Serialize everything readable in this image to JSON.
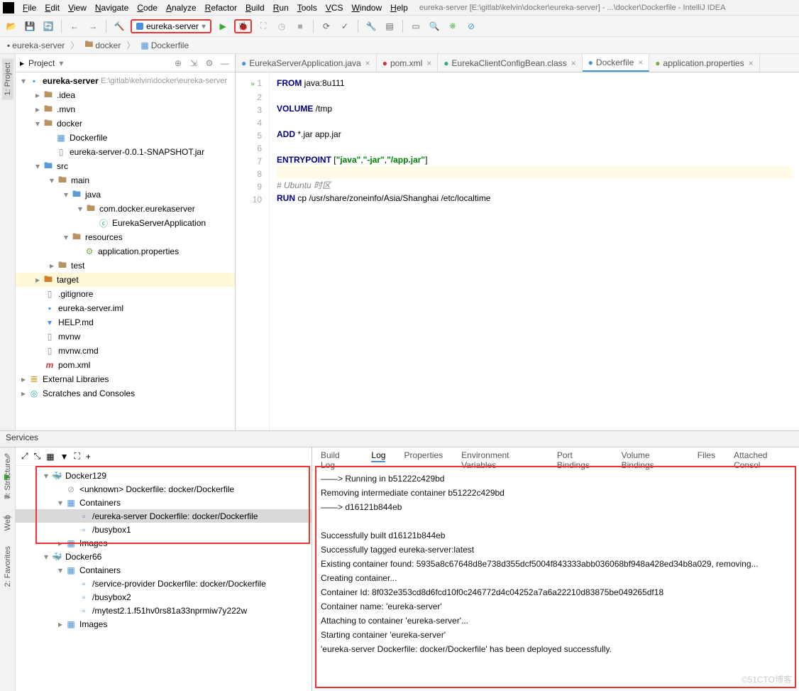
{
  "window": {
    "title": "eureka-server [E:\\gitlab\\kelvin\\docker\\eureka-server] - ...\\docker\\Dockerfile - IntelliJ IDEA"
  },
  "menu": [
    "File",
    "Edit",
    "View",
    "Navigate",
    "Code",
    "Analyze",
    "Refactor",
    "Build",
    "Run",
    "Tools",
    "VCS",
    "Window",
    "Help"
  ],
  "run_config": {
    "label": "eureka-server"
  },
  "breadcrumb": [
    {
      "icon": "module",
      "label": "eureka-server"
    },
    {
      "icon": "folder",
      "label": "docker"
    },
    {
      "icon": "docker",
      "label": "Dockerfile"
    }
  ],
  "project_panel": {
    "title": "Project"
  },
  "tree": {
    "root": {
      "label": "eureka-server",
      "path": "E:\\gitlab\\kelvin\\docker\\eureka-server"
    },
    "idea": ".idea",
    "mvn": ".mvn",
    "docker": "docker",
    "dockerfile": "Dockerfile",
    "snapshot": "eureka-server-0.0.1-SNAPSHOT.jar",
    "src": "src",
    "main": "main",
    "java": "java",
    "pkg": "com.docker.eurekaserver",
    "app": "EurekaServerApplication",
    "resources": "resources",
    "props": "application.properties",
    "test": "test",
    "target": "target",
    "gitignore": ".gitignore",
    "iml": "eureka-server.iml",
    "help": "HELP.md",
    "mvnw": "mvnw",
    "mvnwcmd": "mvnw.cmd",
    "pom": "pom.xml",
    "ext": "External Libraries",
    "scratch": "Scratches and Consoles"
  },
  "editor_tabs": [
    {
      "icon": "java",
      "label": "EurekaServerApplication.java",
      "active": false
    },
    {
      "icon": "maven",
      "label": "pom.xml",
      "active": false
    },
    {
      "icon": "class",
      "label": "EurekaClientConfigBean.class",
      "active": false
    },
    {
      "icon": "docker",
      "label": "Dockerfile",
      "active": true
    },
    {
      "icon": "props",
      "label": "application.properties",
      "active": false
    }
  ],
  "code": {
    "lines": [
      {
        "n": 1,
        "html": "<span class='kw'>FROM</span> java:8u111"
      },
      {
        "n": 2,
        "html": ""
      },
      {
        "n": 3,
        "html": "<span class='kw'>VOLUME</span> /tmp"
      },
      {
        "n": 4,
        "html": ""
      },
      {
        "n": 5,
        "html": "<span class='kw'>ADD</span> *.jar app.jar"
      },
      {
        "n": 6,
        "html": ""
      },
      {
        "n": 7,
        "html": "<span class='kw'>ENTRYPOINT</span> [<span class='str'>\"java\"</span>,<span class='str'>\"-jar\"</span>,<span class='str'>\"/app.jar\"</span>]"
      },
      {
        "n": 8,
        "html": "",
        "caret": true
      },
      {
        "n": 9,
        "html": "<span class='cmt'># Ubuntu 时区</span>"
      },
      {
        "n": 10,
        "html": "<span class='kw'>RUN</span> cp /usr/share/zoneinfo/Asia/Shanghai /etc/localtime"
      }
    ]
  },
  "services": {
    "title": "Services",
    "tabs": [
      "Build Log",
      "Log",
      "Properties",
      "Environment Variables",
      "Port Bindings",
      "Volume Bindings",
      "Files",
      "Attached Consol"
    ],
    "active_tab": "Log",
    "docker129": "Docker129",
    "unknown": "<unknown> Dockerfile: docker/Dockerfile",
    "containers": "Containers",
    "eureka_ct": "/eureka-server Dockerfile: docker/Dockerfile",
    "busybox1": "/busybox1",
    "images": "Images",
    "docker66": "Docker66",
    "svcprovider": "/service-provider Dockerfile: docker/Dockerfile",
    "busybox2": "/busybox2",
    "mytest": "/mytest2.1.f51hv0rs81a33nprmiw7y222w",
    "log": [
      " ——> Running in b51222c429bd",
      "Removing intermediate container b51222c429bd",
      " ——> d16121b844eb",
      "",
      "Successfully built d16121b844eb",
      "Successfully tagged eureka-server:latest",
      "Existing container found: 5935a8c67648d8e738d355dcf5004f843333abb036068bf948a428ed34b8a029, removing...",
      "Creating container...",
      "Container Id: 8f032e353cd8d6fcd10f0c246772d4c04252a7a6a22210d83875be049265df18",
      "Container name: 'eureka-server'",
      "Attaching to container 'eureka-server'...",
      "Starting container 'eureka-server'",
      "'eureka-server Dockerfile: docker/Dockerfile' has been deployed successfully."
    ]
  },
  "side_tabs": {
    "project": "1: Project",
    "structure": "7: Structure",
    "web": "Web",
    "favorites": "2: Favorites"
  },
  "watermark": "©51CTO博客"
}
